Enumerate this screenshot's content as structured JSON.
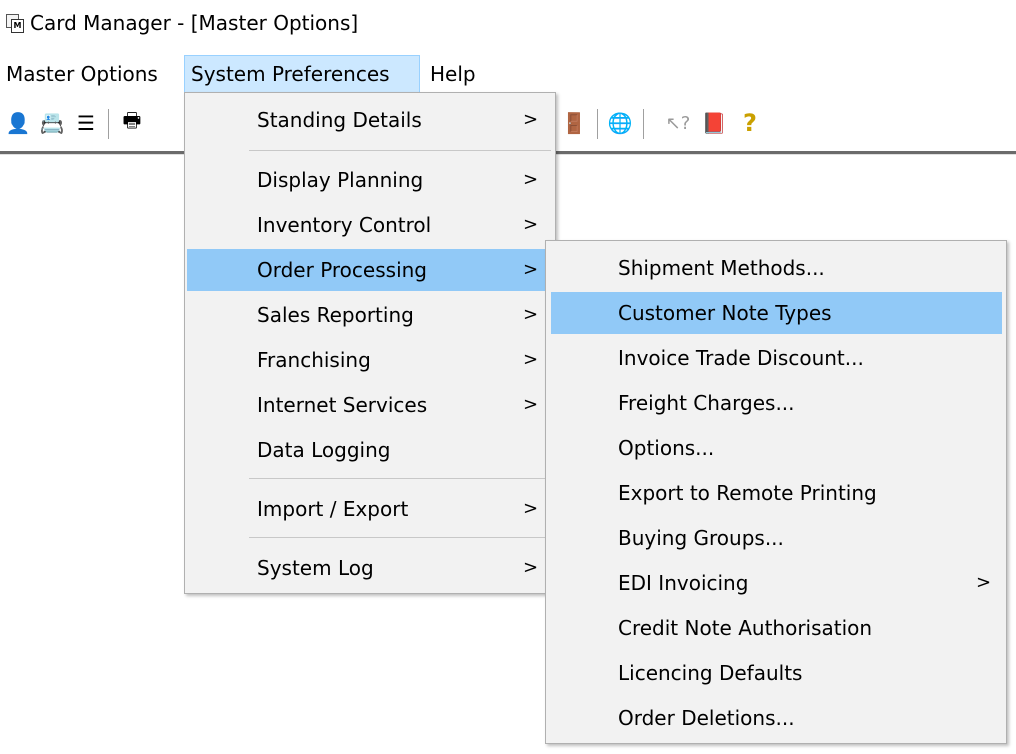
{
  "window": {
    "title": "Card Manager - [Master Options]",
    "icon": "card-manager-app-icon"
  },
  "menubar": {
    "items": [
      {
        "label": "Master Options"
      },
      {
        "label": "System Preferences"
      },
      {
        "label": "Help"
      }
    ]
  },
  "toolbar": {
    "buttons": [
      {
        "icon": "user-icon",
        "glyph": "👤"
      },
      {
        "icon": "address-book-icon",
        "glyph": "📇"
      },
      {
        "icon": "list-icon",
        "glyph": "☰"
      },
      {
        "icon": "printer-icon",
        "glyph": "🖶"
      },
      {
        "icon": "exit-door-icon",
        "glyph": "🚪"
      },
      {
        "icon": "globe-icon",
        "glyph": "🌐"
      },
      {
        "icon": "context-help-icon",
        "glyph": "↖?"
      },
      {
        "icon": "help-book-icon",
        "glyph": "📕"
      },
      {
        "icon": "question-icon",
        "glyph": "?"
      }
    ]
  },
  "system_preferences_menu": {
    "items": [
      {
        "label": "Standing Details",
        "submenu": true
      },
      {
        "label": "Display Planning",
        "submenu": true
      },
      {
        "label": "Inventory Control",
        "submenu": true
      },
      {
        "label": "Order Processing",
        "submenu": true,
        "highlighted": true
      },
      {
        "label": "Sales Reporting",
        "submenu": true
      },
      {
        "label": "Franchising",
        "submenu": true
      },
      {
        "label": "Internet Services",
        "submenu": true
      },
      {
        "label": "Data Logging",
        "submenu": false
      },
      {
        "label": "Import / Export",
        "submenu": true
      },
      {
        "label": "System Log",
        "submenu": true
      }
    ],
    "arrow": ">"
  },
  "order_processing_menu": {
    "items": [
      {
        "label": "Shipment Methods...",
        "submenu": false
      },
      {
        "label": "Customer Note Types",
        "submenu": false,
        "highlighted": true
      },
      {
        "label": "Invoice Trade Discount...",
        "submenu": false
      },
      {
        "label": "Freight Charges...",
        "submenu": false
      },
      {
        "label": "Options...",
        "submenu": false
      },
      {
        "label": "Export to Remote Printing",
        "submenu": false
      },
      {
        "label": "Buying Groups...",
        "submenu": false
      },
      {
        "label": "EDI Invoicing",
        "submenu": true
      },
      {
        "label": "Credit Note Authorisation",
        "submenu": false
      },
      {
        "label": "Licencing Defaults",
        "submenu": false
      },
      {
        "label": "Order Deletions...",
        "submenu": false
      }
    ],
    "arrow": ">"
  },
  "colors": {
    "menu_open_bg": "#cce8ff",
    "item_highlight_bg": "#91c9f7",
    "menu_bg": "#f2f2f2"
  }
}
